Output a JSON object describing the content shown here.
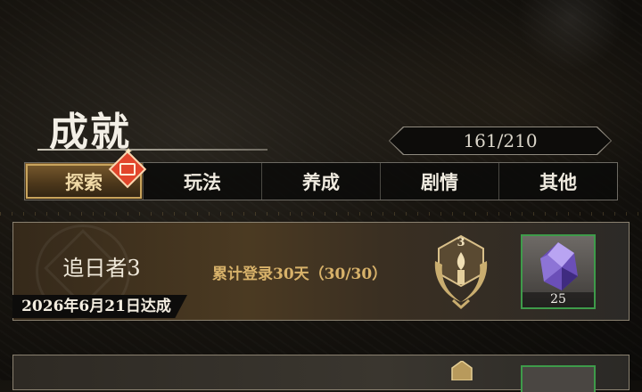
{
  "header": {
    "title": "成就",
    "progress": "161/210"
  },
  "tabs": [
    {
      "label": "探索",
      "active": true,
      "has_badge": true
    },
    {
      "label": "玩法",
      "active": false
    },
    {
      "label": "养成",
      "active": false
    },
    {
      "label": "剧情",
      "active": false
    },
    {
      "label": "其他",
      "active": false
    }
  ],
  "achievements": [
    {
      "name": "追日者3",
      "description": "累计登录30天（30/30）",
      "completed_date": "2026年6月21日达成",
      "medal_level": "3",
      "medal_icon": "laurel-torch-medal-icon",
      "reward": {
        "icon": "purple-crystal-icon",
        "count": "25"
      }
    }
  ],
  "colors": {
    "accent_gold": "#d8b26a",
    "active_tab": "#7a5b2e",
    "badge_red": "#e2462c",
    "reward_border_green": "#3e9b4a"
  }
}
